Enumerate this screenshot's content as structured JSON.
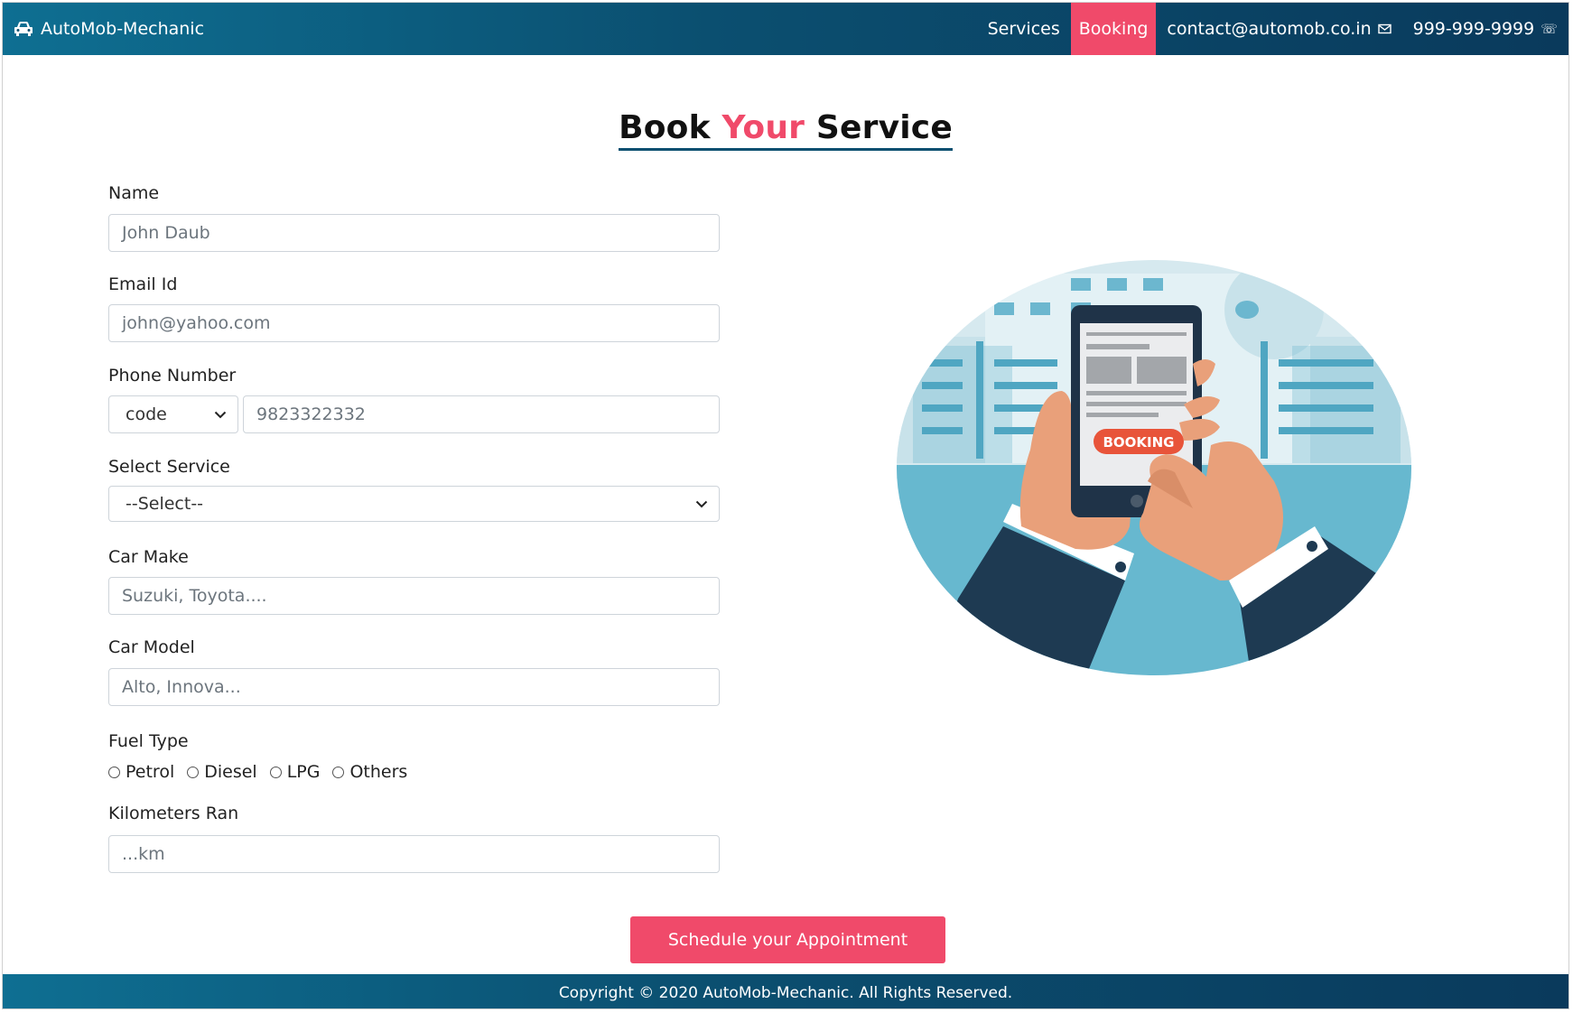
{
  "navbar": {
    "brand": "AutoMob-Mechanic",
    "brand_icon": "car-icon",
    "links": {
      "services": "Services",
      "booking": "Booking",
      "email": "contact@automob.co.in",
      "phone": "999-999-9999"
    },
    "email_icon": "envelope-icon",
    "phone_icon": "telephone-icon",
    "active_color": "#f04a6a"
  },
  "page": {
    "title_part1": "Book",
    "title_accent": "Your",
    "title_part2": "Service"
  },
  "form": {
    "name": {
      "label": "Name",
      "placeholder": "John Daub"
    },
    "email": {
      "label": "Email Id",
      "placeholder": "john@yahoo.com"
    },
    "phone": {
      "label": "Phone Number",
      "code_value": "code",
      "placeholder": "9823322332"
    },
    "service": {
      "label": "Select Service",
      "value": "--Select--"
    },
    "car_make": {
      "label": "Car Make",
      "placeholder": "Suzuki, Toyota...."
    },
    "car_model": {
      "label": "Car Model",
      "placeholder": "Alto, Innova..."
    },
    "fuel": {
      "label": "Fuel Type",
      "options": [
        "Petrol",
        "Diesel",
        "LPG",
        "Others"
      ]
    },
    "km": {
      "label": "Kilometers Ran",
      "placeholder": "...km"
    },
    "submit": "Schedule your Appointment"
  },
  "illustration": {
    "badge": "BOOKING"
  },
  "footer": {
    "text": "Copyright © 2020 AutoMob-Mechanic. All Rights Reserved."
  },
  "colors": {
    "accent": "#f04a6a",
    "nav_dark": "#0a3a5c",
    "nav_light": "#0e6f92"
  }
}
